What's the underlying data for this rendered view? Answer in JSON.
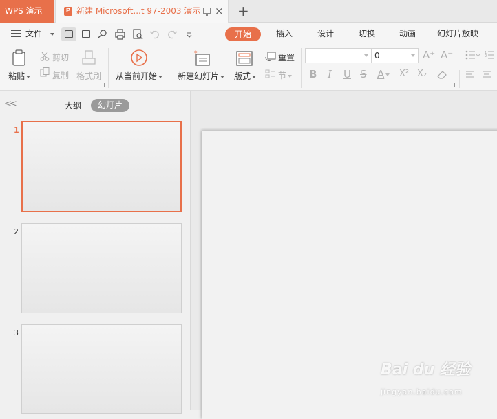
{
  "titlebar": {
    "app_tab": "WPS 演示",
    "doc_icon": "P",
    "doc_title": "新建 Microsoft...t 97-2003 演示",
    "close": "×",
    "new_tab": "+"
  },
  "menubar": {
    "file": "文件",
    "tabs": [
      "开始",
      "插入",
      "设计",
      "切换",
      "动画",
      "幻灯片放映"
    ]
  },
  "ribbon": {
    "paste": "粘贴",
    "cut": "剪切",
    "copy": "复制",
    "format_painter": "格式刷",
    "start_from_current": "从当前开始",
    "new_slide": "新建幻灯片",
    "layout": "版式",
    "reset": "重置",
    "section": "节",
    "font_name": "",
    "font_size": "0",
    "grow_font": "A⁺",
    "shrink_font": "A⁻",
    "bold": "B",
    "italic": "I",
    "underline": "U",
    "strikethrough": "S",
    "font_color": "A",
    "superscript": "X²",
    "subscript": "X₂"
  },
  "left_panel": {
    "collapse": "<<",
    "outline_tab": "大纲",
    "slides_tab": "幻灯片",
    "slides": [
      {
        "number": "1",
        "selected": true
      },
      {
        "number": "2",
        "selected": false
      },
      {
        "number": "3",
        "selected": false
      }
    ]
  },
  "watermark": {
    "main": "Bai du 经验",
    "sub": "jingyan.baidu.com"
  },
  "colors": {
    "accent": "#e8704a",
    "pill_gray": "#9a9a9a"
  }
}
